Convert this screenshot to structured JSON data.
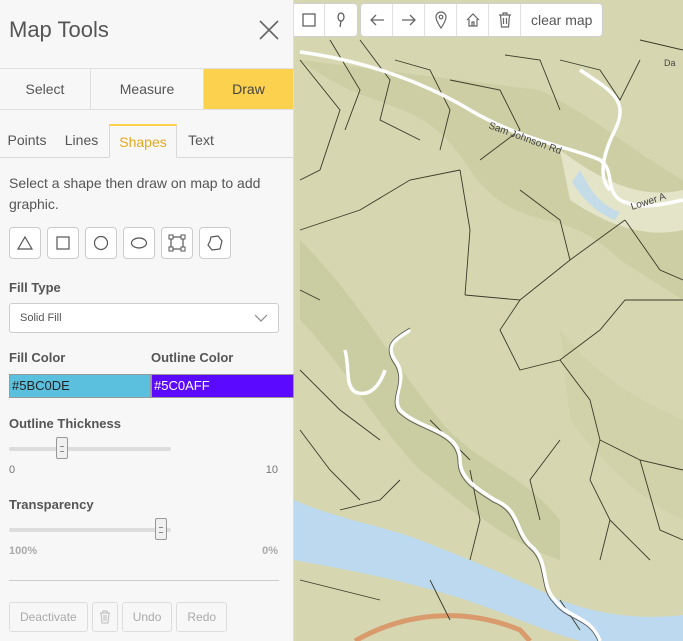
{
  "panel": {
    "title": "Map Tools",
    "modes": [
      {
        "label": "Select",
        "active": false
      },
      {
        "label": "Measure",
        "active": false
      },
      {
        "label": "Draw",
        "active": true
      }
    ],
    "subtabs": [
      {
        "label": "Points",
        "active": false
      },
      {
        "label": "Lines",
        "active": false
      },
      {
        "label": "Shapes",
        "active": true
      },
      {
        "label": "Text",
        "active": false
      }
    ],
    "instructions": "Select a shape then draw on map to add graphic.",
    "shape_tools": [
      "triangle-icon",
      "square-icon",
      "circle-icon",
      "ellipse-icon",
      "rectangle-handles-icon",
      "freehand-polygon-icon"
    ],
    "fill_type_label": "Fill Type",
    "fill_type_value": "Solid Fill",
    "fill_color_label": "Fill Color",
    "fill_color_value": "#5BC0DE",
    "outline_color_label": "Outline Color",
    "outline_color_value": "#5C0AFF",
    "outline_thickness_label": "Outline Thickness",
    "outline_thickness_min": "0",
    "outline_thickness_max": "10",
    "outline_thickness_level": 0.31,
    "transparency_label": "Transparency",
    "transparency_min": "100%",
    "transparency_max": "0%",
    "transparency_level": 0.97,
    "actions": {
      "deactivate": "Deactivate",
      "undo": "Undo",
      "redo": "Redo"
    }
  },
  "toolbar": {
    "clear_map": "clear map"
  },
  "map": {
    "road_label": "Sam Johnson Rd",
    "road_label_2": "Lower A",
    "road_label_3": "Da"
  },
  "colors": {
    "accent": "#fcd14e",
    "fill": "#5bc0de",
    "outline": "#5c0aff",
    "water": "#bcd9ef",
    "land": "#d6d7b0"
  }
}
